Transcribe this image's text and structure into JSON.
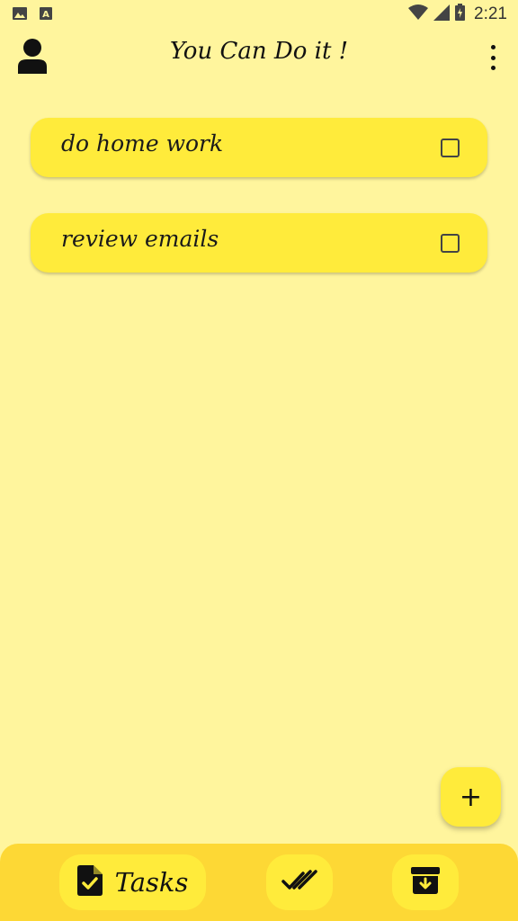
{
  "status_bar": {
    "time": "2:21",
    "left_icons": [
      "image-icon",
      "keyboard-a-icon"
    ],
    "right_icons": [
      "wifi-icon",
      "signal-icon",
      "battery-icon"
    ]
  },
  "app_bar": {
    "title": "You Can Do it !",
    "left_icon": "person-icon",
    "right_icon": "more-vert-icon"
  },
  "tasks": [
    {
      "text": "do home work",
      "checked": false
    },
    {
      "text": "review emails",
      "checked": false
    }
  ],
  "fab": {
    "label": "+",
    "icon": "plus-icon"
  },
  "bottom_nav": {
    "items": [
      {
        "label": "Tasks",
        "icon": "task-file-icon",
        "active": true
      },
      {
        "label": "",
        "icon": "double-check-icon"
      },
      {
        "label": "",
        "icon": "archive-icon"
      }
    ]
  },
  "colors": {
    "background": "#FFF59D",
    "card": "#FFEB3B",
    "nav": "#FDD835"
  }
}
